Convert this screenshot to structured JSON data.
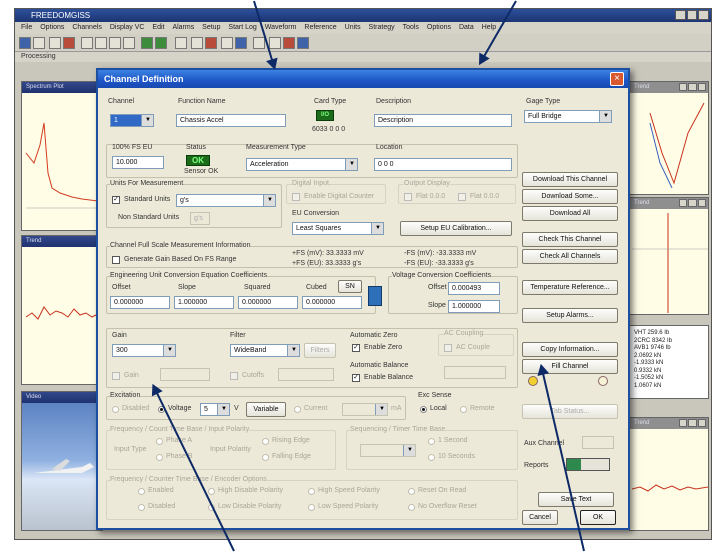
{
  "app": {
    "title": "FREEDOMGISS",
    "menu": [
      "File",
      "Options",
      "Channels",
      "Display VC",
      "Edit",
      "Alarms",
      "Setup",
      "Start Log",
      "Waveform",
      "Reference",
      "Units",
      "Strategy",
      "Tools",
      "Options",
      "Data",
      "Help"
    ],
    "status_line": "Processing",
    "child_windows": [
      {
        "title": "Spectrum Plot"
      },
      {
        "title": "Trend"
      },
      {
        "title": "Video"
      },
      {
        "title": "Trend"
      },
      {
        "title": "Trend"
      }
    ],
    "readout_rows": [
      "VHT  259.6  Ib",
      "2CRC  8342  Ib",
      "AVB1  9746  Ib",
      "2.0692  kN",
      "-1.9333  kN",
      "0.9332  kN",
      "-1.5052  kN",
      "1.0607  kN"
    ]
  },
  "dialog": {
    "title": "Channel Definition",
    "channel": {
      "label": "Channel",
      "value": "1"
    },
    "function_name": {
      "label": "Function Name",
      "value": "Chassis Accel"
    },
    "card_type": {
      "label": "Card Type",
      "code": "6033 0 0 0"
    },
    "description": {
      "label": "Description",
      "value": "Description"
    },
    "gage_type": {
      "label": "Gage Type",
      "value": "Full Bridge"
    },
    "fs_eu": {
      "label": "100% FS EU",
      "value": "10.000"
    },
    "status": {
      "label": "Status",
      "value": "OK",
      "sub": "Sensor OK"
    },
    "measurement_type": {
      "label": "Measurement Type",
      "value": "Acceleration"
    },
    "location": {
      "label": "Location",
      "value": "0 0 0"
    },
    "units": {
      "group_label": "Units For Measurement",
      "standard_label": "Standard Units",
      "standard_value": "g's",
      "nonstandard_label": "Non Standard Units",
      "nonstandard_value": "g's"
    },
    "digital_input": {
      "label": "Digital Input",
      "option": "Enable Digital Counter"
    },
    "output_display": {
      "label": "Output Display",
      "opt1": "Flat 0.0.0",
      "opt2": "Flat 0.0.0"
    },
    "eu_conversion": {
      "label": "EU Conversion",
      "value": "Least Squares"
    },
    "setup_eu_btn": "Setup EU Calibration...",
    "fs_info": {
      "group_label": "Channel Full Scale Measurement Information",
      "gen_gain_label": "Generate Gain Based On FS Range",
      "pos_mv": "+FS (mV):  33.3333 mV",
      "pos_eu": "+FS (EU):  33.3333 g's",
      "neg_mv": "-FS (mV):  -33.3333 mV",
      "neg_eu": "-FS (EU):  -33.3333 g's"
    },
    "coeffs": {
      "group_label": "Engineering Unit Conversion Equation Coefficients",
      "offset_label": "Offset",
      "slope_label": "Slope",
      "squared_label": "Squared",
      "cubed_label": "Cubed",
      "offset": "0.000000",
      "slope": "1.000000",
      "squared": "0.000000",
      "cubed": "0.000000",
      "sn_btn": "SN"
    },
    "voltage_coeffs": {
      "group_label": "Voltage Conversion Coefficients",
      "offset_label": "Offset",
      "offset": "0.000493",
      "slope_label": "Slope",
      "slope": "1.000000"
    },
    "gain": {
      "label": "Gain",
      "value": "300",
      "sub": "Gain"
    },
    "filter": {
      "label": "Filter",
      "value": "WideBand",
      "btn": "Filters",
      "cutoff": "Cutoffs"
    },
    "auto_zero": {
      "label": "Automatic Zero",
      "option": "Enable Zero"
    },
    "ac_coupling": {
      "label": "AC Coupling",
      "option": "AC Couple"
    },
    "auto_balance": {
      "label": "Automatic Balance",
      "option": "Enable Balance"
    },
    "excitation": {
      "label": "Excitation",
      "disabled": "Disabled",
      "voltage_label": "Voltage",
      "voltage_value": "5",
      "unit": "V",
      "variable_label": "Variable",
      "current_label": "Current",
      "ma": "mA"
    },
    "exc_sense": {
      "label": "Exc Sense",
      "local": "Local",
      "remote": "Remote"
    },
    "freq_time_base": {
      "label": "Frequency / Count  Time Base / Input Polarity",
      "input_type": "Input Type",
      "a": "Phase A",
      "b": "Phase B",
      "input_polarity": "Input Polarity",
      "rising": "Rising Edge",
      "falling": "Falling Edge"
    },
    "sequence": {
      "label": "Sequencing / Timer Time Base",
      "value": "",
      "opt1": "1 Second",
      "opt2": "10 Seconds"
    },
    "thermo": {
      "label": "Frequency / Counter Time Base / Encoder Options",
      "r1": "Enabled",
      "r2": "High Disable Polarity",
      "r3": "High Speed Polarity",
      "r4": "Reset On Read",
      "r5": "Disabled",
      "r6": "Low Disable Polarity",
      "r7": "Low Speed Polarity",
      "r8": "No Overflow Reset"
    },
    "right_buttons": {
      "download_channel": "Download This Channel",
      "download_some": "Download Some...",
      "download_all": "Download All",
      "check_channel": "Check This Channel",
      "check_all": "Check All Channels",
      "temp_ref": "Temperature Reference...",
      "setup_alarms": "Setup Alarms...",
      "copy_info": "Copy Information...",
      "fill_channel": "Fill Channel",
      "tab_status": "Tab Status...",
      "aux_channel": "Aux Channel",
      "reports": "Reports",
      "save_text": "Save Text",
      "cancel": "Cancel",
      "ok": "OK"
    }
  }
}
